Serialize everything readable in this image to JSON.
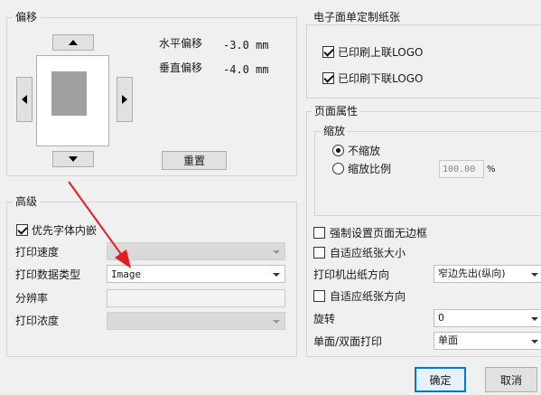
{
  "offset": {
    "title": "偏移",
    "horizontal_label": "水平偏移",
    "horizontal_value": "-3.0 mm",
    "vertical_label": "垂直偏移",
    "vertical_value": "-4.0 mm",
    "reset_label": "重置"
  },
  "advanced": {
    "title": "高级",
    "embed_font_label": "优先字体内嵌",
    "embed_font_checked": true,
    "print_speed_label": "打印速度",
    "print_speed_value": "",
    "data_type_label": "打印数据类型",
    "data_type_value": "Image",
    "resolution_label": "分辨率",
    "resolution_value": "",
    "density_label": "打印浓度",
    "density_value": ""
  },
  "custom_paper": {
    "title": "电子面单定制纸张",
    "upper_logo_label": "已印刷上联LOGO",
    "upper_logo_checked": true,
    "lower_logo_label": "已印刷下联LOGO",
    "lower_logo_checked": true
  },
  "page_props": {
    "title": "页面属性",
    "scale_title": "缩放",
    "no_scale_label": "不缩放",
    "scale_ratio_label": "缩放比例",
    "scale_ratio_value": "100.00",
    "percent_sign": "%",
    "selected_scale": "no_scale",
    "force_borderless_label": "强制设置页面无边框",
    "fit_paper_size_label": "自适应纸张大小",
    "feed_direction_label": "打印机出纸方向",
    "feed_direction_value": "窄边先出(纵向)",
    "fit_paper_direction_label": "自适应纸张方向",
    "rotate_label": "旋转",
    "rotate_value": "0",
    "duplex_label": "单面/双面打印",
    "duplex_value": "单面"
  },
  "footer": {
    "ok_label": "确定",
    "cancel_label": "取消"
  },
  "colors": {
    "annotation_arrow": "#e02020",
    "ok_border": "#0078d7",
    "preview_page": "#a0a0a0"
  }
}
